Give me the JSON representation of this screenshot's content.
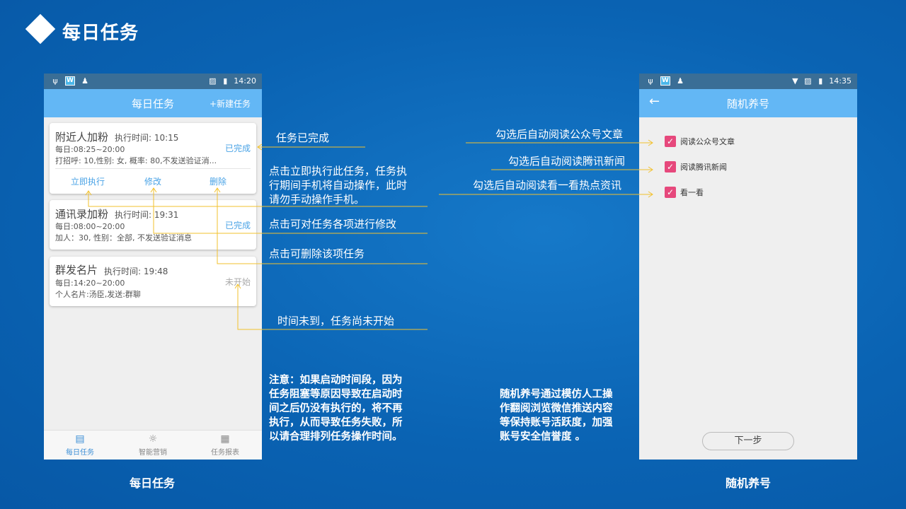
{
  "slide": {
    "title": "每日任务"
  },
  "phone_left": {
    "status": {
      "time": "14:20"
    },
    "appbar": {
      "title": "每日任务",
      "action": "+新建任务"
    },
    "tasks": [
      {
        "name": "附近人加粉",
        "exec_time": "执行时间: 10:15",
        "schedule": "每日:08:25~20:00",
        "detail": "打招呼: 10,性别: 女, 概率: 80,不发送验证消...",
        "status": "已完成",
        "actions": {
          "run": "立即执行",
          "edit": "修改",
          "delete": "删除"
        }
      },
      {
        "name": "通讯录加粉",
        "exec_time": "执行时间: 19:31",
        "schedule": "每日:08:00~20:00",
        "detail": "加人：30, 性别：全部, 不发送验证消息",
        "status": "已完成"
      },
      {
        "name": "群发名片",
        "exec_time": "执行时间: 19:48",
        "schedule": "每日:14:20~20:00",
        "detail": "个人名片:汤臣,发送:群聊",
        "status": "未开始"
      }
    ],
    "bottom_nav": [
      {
        "label": "每日任务",
        "icon": "task-list-icon"
      },
      {
        "label": "智能营销",
        "icon": "lightbulb-icon"
      },
      {
        "label": "任务报表",
        "icon": "clipboard-icon"
      }
    ],
    "caption": "每日任务"
  },
  "phone_right": {
    "status": {
      "time": "14:35"
    },
    "appbar": {
      "title": "随机养号"
    },
    "checkboxes": [
      {
        "label": "阅读公众号文章",
        "checked": true
      },
      {
        "label": "阅读腾讯新闻",
        "checked": true
      },
      {
        "label": "看一看",
        "checked": true
      }
    ],
    "next_button": "下一步",
    "caption": "随机养号"
  },
  "annotations": {
    "completed": "任务已完成",
    "run_now": [
      "点击立即执行此任务，任务执",
      "行期间手机将自动操作，此时",
      "请勿手动操作手机。"
    ],
    "edit": "点击可对任务各项进行修改",
    "delete": "点击可删除该项任务",
    "not_started": "时间未到，任务尚未开始",
    "read_articles": "勾选后自动阅读公众号文章",
    "read_news": "勾选后自动阅读腾讯新闻",
    "read_kankan": "勾选后自动阅读看一看热点资讯"
  },
  "notes": {
    "left": [
      "注意：如果启动时间段，因为",
      "任务阻塞等原因导致在启动时",
      "间之后仍没有执行的，将不再",
      "执行，从而导致任务失败，所",
      "以请合理排列任务操作时间。"
    ],
    "right": [
      "随机养号通过模仿人工操",
      "作翻阅浏览微信推送内容",
      "等保持账号活跃度，加强",
      "账号安全信誉度 。"
    ]
  },
  "colors": {
    "accent_yellow": "#f2c12e",
    "appbar_blue": "#63b7f5",
    "checkbox_pink": "#e6487c"
  }
}
